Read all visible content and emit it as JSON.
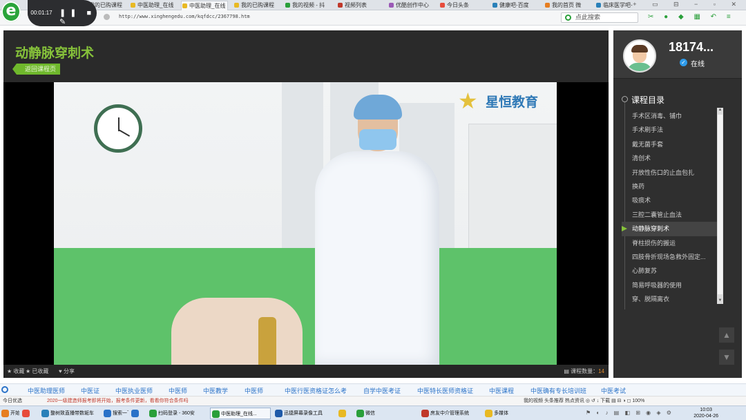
{
  "browser": {
    "logo": "e",
    "tabs": [
      {
        "label": "我的已购课程",
        "color": "#e74c3c"
      },
      {
        "label": "中医助理_在线",
        "color": "#e8b923"
      },
      {
        "label": "中医助理_在线",
        "color": "#e8b923",
        "active": true
      },
      {
        "label": "我的已购课程",
        "color": "#e8b923"
      },
      {
        "label": "我的视频 - 抖",
        "color": "#2a9f3a"
      },
      {
        "label": "视频列表",
        "color": "#c0392b"
      },
      {
        "label": "优酷创作中心",
        "color": "#9b59b6"
      },
      {
        "label": "今日头条",
        "color": "#e74c3c"
      },
      {
        "label": "健康吧-百度",
        "color": "#2980b9"
      },
      {
        "label": "我的首页 微",
        "color": "#e67e22"
      },
      {
        "label": "临床医学吧-",
        "color": "#2980b9"
      }
    ],
    "tab_controls": "+ ▭ ⊟ − ▫ ✕",
    "url": "http://www.xinghengedu.com/kqfdcc/2367798.htm",
    "search_placeholder": "点此搜索",
    "toolbar_icons": "✂ ● ◆ ▦ ↶ ≡"
  },
  "recorder": {
    "time": "00:01:17",
    "buttons": "❚❚ ■ ✎"
  },
  "player": {
    "course_title": "动静脉穿刺术",
    "back_label": "返回课程页",
    "brand": "星恒教育",
    "collect_label": "收藏",
    "collected_label": "已收藏",
    "share_label": "分享",
    "course_count_label": "课程数量：",
    "course_count": "14"
  },
  "side": {
    "username": "18174...",
    "status": "在线",
    "catalog_title": "课程目录",
    "lessons": [
      "手术区消毒、铺巾",
      "手术刷手法",
      "戴无菌手套",
      "清创术",
      "开放性伤口的止血包扎",
      "换药",
      "吸痰术",
      "三腔二囊管止血法",
      "动静脉穿刺术",
      "脊柱损伤的搬运",
      "四肢骨折现场急救外固定...",
      "心肺复苏",
      "简易呼吸器的使用",
      "穿、脱隔离衣"
    ],
    "active_index": 8
  },
  "navlinks": [
    "中医助理医师",
    "中医证",
    "中医执业医师",
    "中医师",
    "中医教学",
    "中医师",
    "中医行医资格证怎么考",
    "自学中医考证",
    "中医特长医师资格证",
    "中医课程",
    "中医确有专长培训班",
    "中医考试"
  ],
  "statusbar": {
    "left": "今日优选",
    "news": "2020一级建造师报考即将开始，报考条件更新，看看你符合条件吗",
    "right": "我的视频   头条推荐   热点资讯   ◎   ↺   ↓ 下载   ▤   ⊟   ◑   ◻   100%"
  },
  "taskbar": {
    "tasks": [
      {
        "label": "开始",
        "color": "#e67e22"
      },
      {
        "label": "",
        "color": "#e74c3c"
      },
      {
        "label": "整树致直播带数轭车",
        "color": "#2980b9"
      },
      {
        "label": "搜索一下",
        "color": "#2a72c8"
      },
      {
        "label": "",
        "color": "#2a72c8"
      },
      {
        "label": "扫码登录 - 360安",
        "color": "#2a9f3a"
      },
      {
        "label": "中医助理_在线...",
        "color": "#2a9f3a",
        "active": true
      },
      {
        "label": "迅捷屏幕录像工具",
        "color": "#1f5aa8"
      },
      {
        "label": "",
        "color": "#e8b923"
      },
      {
        "label": "微信",
        "color": "#2a9f3a"
      },
      {
        "label": "房友中介管理系统",
        "color": "#c0392b"
      },
      {
        "label": "多媒体",
        "color": "#e8b923"
      }
    ],
    "tray": "⚑ ◐ ♪ ▤ ◧ ⊞ ◉ ◈ ⚙",
    "time": "10:03",
    "date": "2020-04-26"
  }
}
